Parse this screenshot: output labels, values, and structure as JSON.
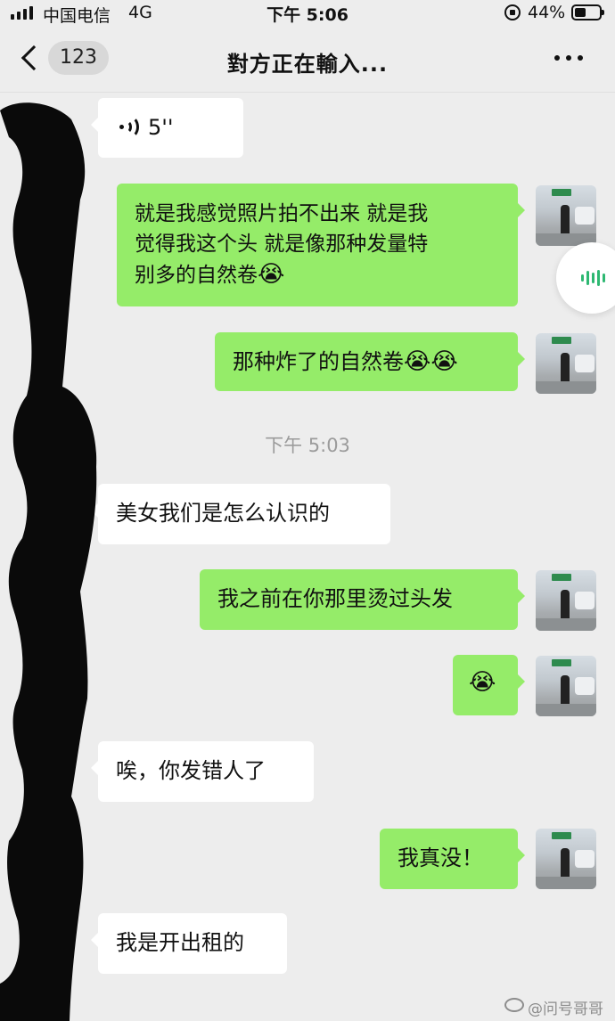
{
  "status_bar": {
    "carrier": "中国电信",
    "network": "4G",
    "time": "下午 5:06",
    "battery": "44%"
  },
  "nav": {
    "unread_count": "123",
    "title": "對方正在輸入..."
  },
  "messages": [
    {
      "type": "voice",
      "side": "in",
      "duration": "5''"
    },
    {
      "type": "text",
      "side": "out",
      "lines": [
        "就是我感觉照片拍不出来 就是我",
        "觉得我这个头 就是像那种发量特",
        "别多的自然卷"
      ],
      "emoji": "😭"
    },
    {
      "type": "text",
      "side": "out",
      "text": "那种炸了的自然卷",
      "emoji": "😭😭"
    },
    {
      "type": "text",
      "side": "in",
      "text": "美女我们是怎么认识的"
    },
    {
      "type": "text",
      "side": "out",
      "text": "我之前在你那里烫过头发"
    },
    {
      "type": "emoji",
      "side": "out",
      "emoji": "😭"
    },
    {
      "type": "text",
      "side": "in",
      "text": "唉，你发错人了"
    },
    {
      "type": "text",
      "side": "out",
      "text": "我真没！"
    },
    {
      "type": "text",
      "side": "in",
      "text": "我是开出租的"
    }
  ],
  "timestamp": "下午 5:03",
  "watermark": "@问号哥哥",
  "colors": {
    "background": "#ededed",
    "outgoing_bubble": "#95ec69",
    "incoming_bubble": "#ffffff",
    "voice_accent": "#2eb872"
  }
}
